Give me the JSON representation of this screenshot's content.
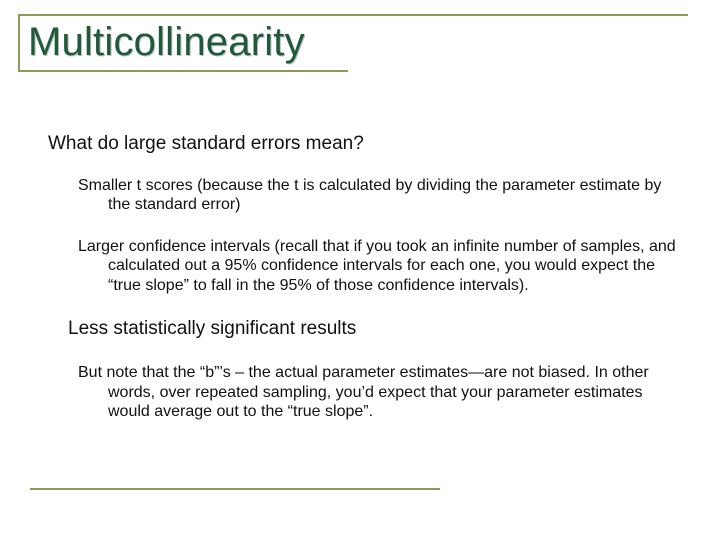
{
  "title": "Multicollinearity",
  "body": {
    "q": "What do large standard errors mean?",
    "p1": "Smaller t scores (because the t is calculated by dividing the parameter estimate by the standard error)",
    "p2": "Larger confidence intervals (recall that if you took an infinite number of samples, and calculated out a 95% confidence intervals for each one, you would expect the “true slope” to fall in the 95% of those confidence intervals).",
    "p3": "Less statistically significant results",
    "p4": "But note that the “b”’s – the actual parameter estimates—are not biased. In other words, over repeated sampling, you’d expect that your parameter estimates would average out to the “true slope”."
  }
}
